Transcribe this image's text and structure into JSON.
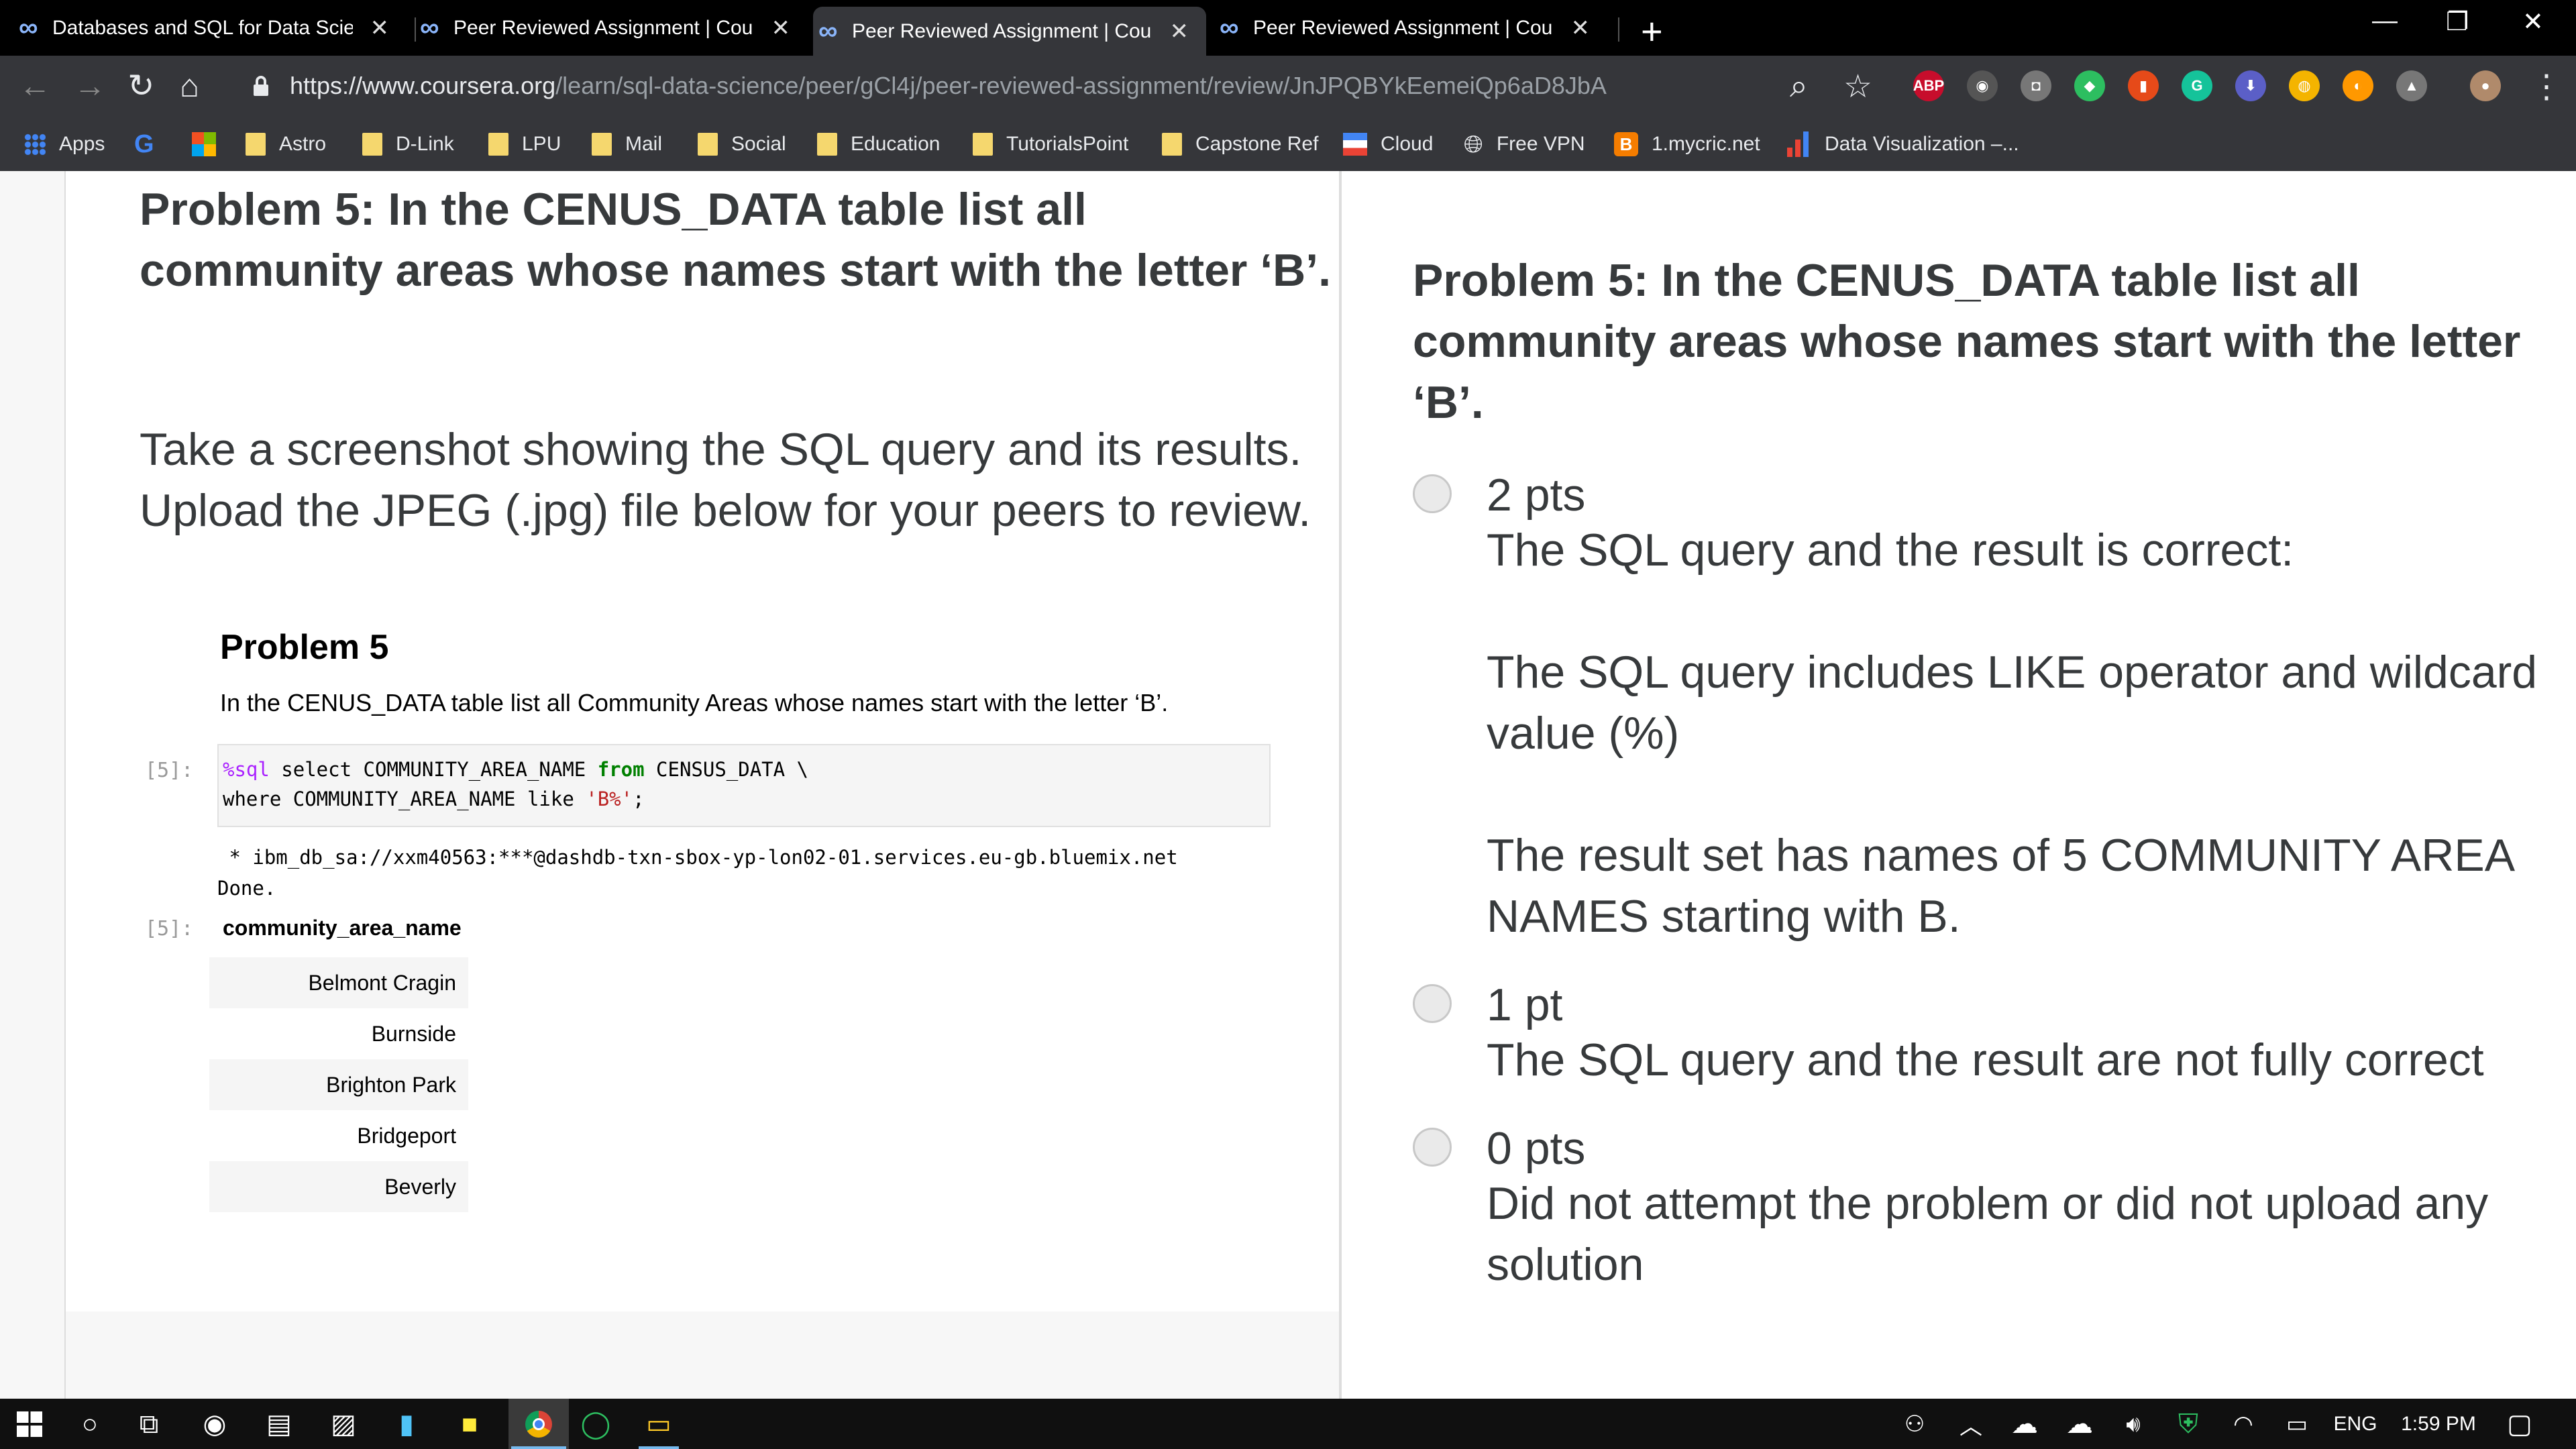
{
  "browser": {
    "tabs": [
      {
        "label": "Databases and SQL for Data Scie",
        "active": false
      },
      {
        "label": "Peer Reviewed Assignment | Cou",
        "active": false
      },
      {
        "label": "Peer Reviewed Assignment | Cou",
        "active": true
      },
      {
        "label": "Peer Reviewed Assignment | Cou",
        "active": false
      }
    ],
    "url_host": "https://www.coursera.org",
    "url_path": "/learn/sql-data-science/peer/gCl4j/peer-reviewed-assignment/review/JnJPQBYkEemeiQp6aD8JbA",
    "extensions": [
      {
        "name": "adblock-plus-icon",
        "label": "ABP",
        "color": "#c70d2c"
      },
      {
        "name": "speed-icon",
        "label": "◉",
        "color": "#555"
      },
      {
        "name": "camera-icon",
        "label": "◘",
        "color": "#777"
      },
      {
        "name": "evernote-icon",
        "label": "◆",
        "color": "#2dbe60"
      },
      {
        "name": "office-icon",
        "label": "▮",
        "color": "#e64a19"
      },
      {
        "name": "grammarly-icon",
        "label": "G",
        "color": "#15c39a"
      },
      {
        "name": "download-icon",
        "label": "⬇",
        "color": "#5b5fc7"
      },
      {
        "name": "colorpick-icon",
        "label": "◍",
        "color": "#f4b400"
      },
      {
        "name": "moon-icon",
        "label": "◐",
        "color": "#ff9800"
      },
      {
        "name": "drive-icon",
        "label": "▲",
        "color": "#777"
      }
    ],
    "bookmarks": [
      {
        "label": "Apps",
        "icon": "apps-icon"
      },
      {
        "label": "",
        "icon": "google-icon"
      },
      {
        "label": "",
        "icon": "microsoft-icon"
      },
      {
        "label": "Astro",
        "icon": "folder-icon"
      },
      {
        "label": "D-Link",
        "icon": "folder-icon"
      },
      {
        "label": "LPU",
        "icon": "folder-icon"
      },
      {
        "label": "Mail",
        "icon": "folder-icon"
      },
      {
        "label": "Social",
        "icon": "folder-icon"
      },
      {
        "label": "Education",
        "icon": "folder-icon"
      },
      {
        "label": "TutorialsPoint",
        "icon": "folder-icon"
      },
      {
        "label": "Capstone Ref",
        "icon": "folder-icon"
      },
      {
        "label": "Cloud",
        "icon": "cloud-bookmark-icon"
      },
      {
        "label": "Free VPN",
        "icon": "globe-icon"
      },
      {
        "label": "1.mycric.net",
        "icon": "blogger-icon"
      },
      {
        "label": "Data Visualization –...",
        "icon": "chart-icon"
      }
    ]
  },
  "left": {
    "title": "Problem 5: In the CENUS_DATA table list all community areas whose names start with the letter ‘B’.",
    "instructions": "Take a screenshot showing the SQL query and its results. Upload the JPEG (.jpg) file below for your peers to review.",
    "notebook": {
      "heading": "Problem 5",
      "subheading": "In the CENUS_DATA table list all Community Areas whose names start with the letter ‘B’.",
      "prompt_in": "[5]:",
      "prompt_out": "[5]:",
      "code_line1_magic": "%sql",
      "code_line1_a": " select COMMUNITY_AREA_NAME ",
      "code_line1_kw": "from",
      "code_line1_b": " CENSUS_DATA \\",
      "code_line2_a": "where COMMUNITY_AREA_NAME like ",
      "code_line2_str": "'B%'",
      "code_line2_b": ";",
      "output_line1": " * ibm_db_sa://xxm40563:***@dashdb-txn-sbox-yp-lon02-01.services.eu-gb.bluemix.net",
      "output_line2": "Done.",
      "column_header": "community_area_name",
      "rows": [
        "Belmont Cragin",
        "Burnside",
        "Brighton Park",
        "Bridgeport",
        "Beverly"
      ]
    }
  },
  "right": {
    "title": "Problem 5: In the CENUS_DATA table list all community areas whose names start with the letter ‘B’.",
    "options": [
      {
        "points": "2 pts",
        "desc": [
          "The SQL query and the result is correct:",
          "The SQL query includes LIKE operator and wildcard value (%)",
          "The result set has names of 5 COMMUNITY AREA NAMES starting with B."
        ]
      },
      {
        "points": "1 pt",
        "desc": [
          "The SQL query and the result are not fully correct"
        ]
      },
      {
        "points": "0 pts",
        "desc": [
          "Did not attempt the problem or did not upload any solution"
        ]
      }
    ]
  },
  "taskbar": {
    "language": "ENG",
    "time": "1:59 PM"
  }
}
